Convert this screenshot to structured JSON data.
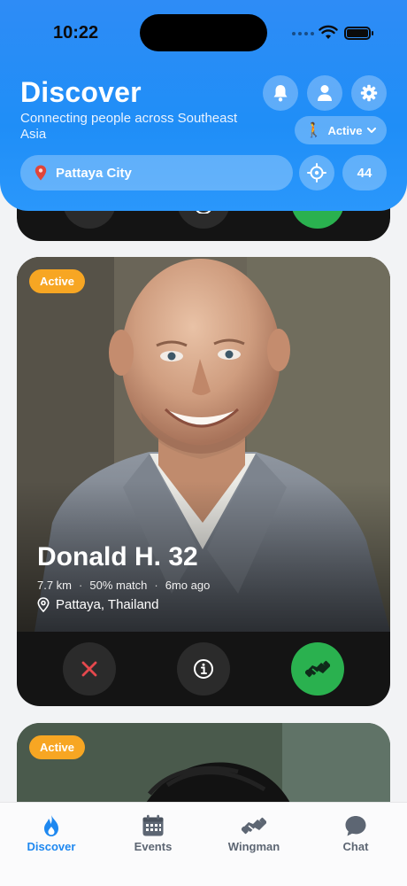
{
  "status_bar": {
    "time": "10:22"
  },
  "header": {
    "title": "Discover",
    "subtitle": "Connecting people across Southeast Asia",
    "status_pill": {
      "label": "Active"
    },
    "location": {
      "value": "Pattaya City"
    },
    "result_count": "44"
  },
  "cards": [
    {
      "badge": "Active",
      "name": "Donald H. 32",
      "distance": "7.7 km",
      "match": "50% match",
      "last_seen": "6mo ago",
      "location": "Pattaya, Thailand"
    },
    {
      "badge": "Active"
    }
  ],
  "tabbar": {
    "items": [
      {
        "label": "Discover",
        "icon": "flame-icon",
        "active": true
      },
      {
        "label": "Events",
        "icon": "calendar-icon"
      },
      {
        "label": "Wingman",
        "icon": "handshake-icon"
      },
      {
        "label": "Chat",
        "icon": "chat-bubble-icon"
      }
    ]
  },
  "colors": {
    "header_blue": "#1f8ef7",
    "badge_orange": "#f7a623",
    "wingman_green": "#2ab14f",
    "pass_red": "#e5484d",
    "tab_active": "#1e88f0"
  }
}
